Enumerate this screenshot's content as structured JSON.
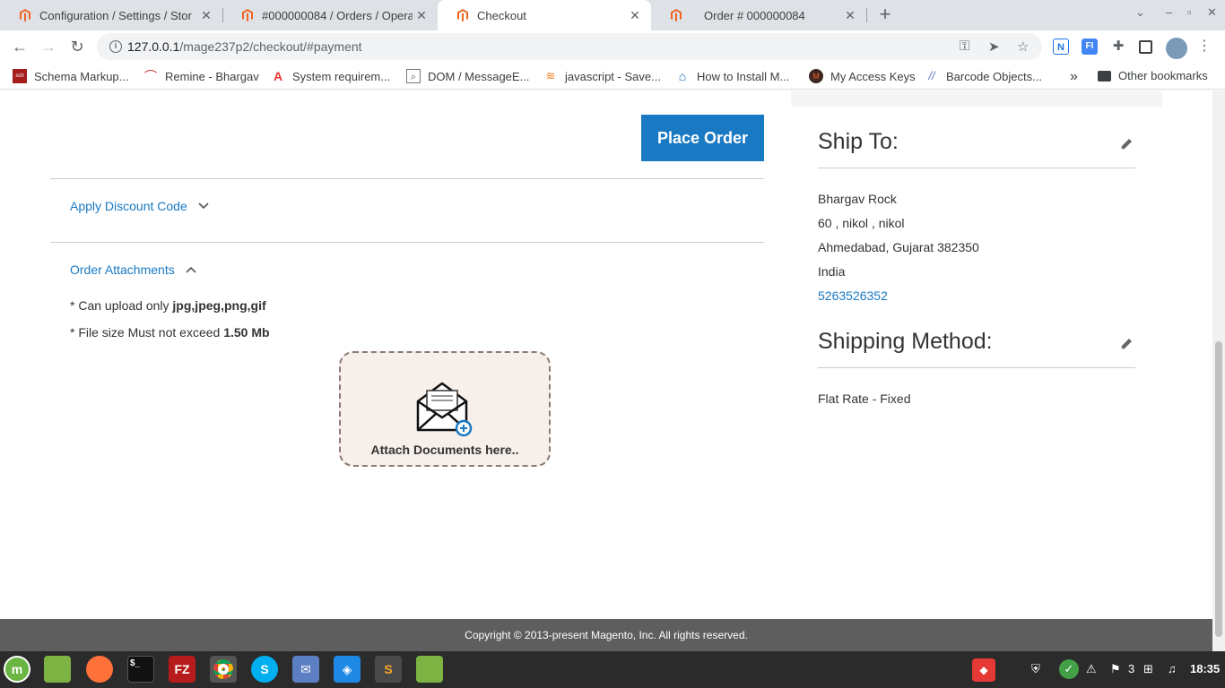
{
  "browser": {
    "tabs": [
      {
        "title": "Configuration / Settings / Stor"
      },
      {
        "title": "#000000084 / Orders / Operat"
      },
      {
        "title": "Checkout"
      },
      {
        "title": "Order # 000000084"
      }
    ],
    "new_tab": "+",
    "url_host": "127.0.0.1",
    "url_path": "/mage237p2/checkout/#payment",
    "bookmarks": [
      {
        "label": "Schema Markup..."
      },
      {
        "label": "Remine - Bhargav"
      },
      {
        "label": "System requirem..."
      },
      {
        "label": "DOM / MessageE..."
      },
      {
        "label": "javascript - Save..."
      },
      {
        "label": "How to Install M..."
      },
      {
        "label": "My Access Keys"
      },
      {
        "label": "Barcode Objects..."
      }
    ],
    "more_bookmarks": "»",
    "other_bookmarks": "Other bookmarks",
    "accent": "#1979c3"
  },
  "checkout": {
    "place_order": "Place Order",
    "discount_label": "Apply Discount Code",
    "attachments_label": "Order Attachments",
    "upload_note_prefix": "* Can upload only ",
    "upload_note_types": "jpg,jpeg,png,gif",
    "size_note_prefix": "* File size Must not exceed ",
    "size_note_value": "1.50 Mb",
    "dropzone_label": "Attach Documents here.."
  },
  "sidebar": {
    "ship_to_title": "Ship To:",
    "address": {
      "name": "Bhargav Rock",
      "street": "60 , nikol , nikol",
      "city_line": "Ahmedabad, Gujarat 382350",
      "country": "India",
      "phone": "5263526352"
    },
    "shipping_method_title": "Shipping Method:",
    "shipping_method": "Flat Rate - Fixed"
  },
  "footer": {
    "copyright": "Copyright © 2013-present Magento, Inc. All rights reserved."
  },
  "taskbar": {
    "workspace_count": "3",
    "clock": "18:35"
  }
}
